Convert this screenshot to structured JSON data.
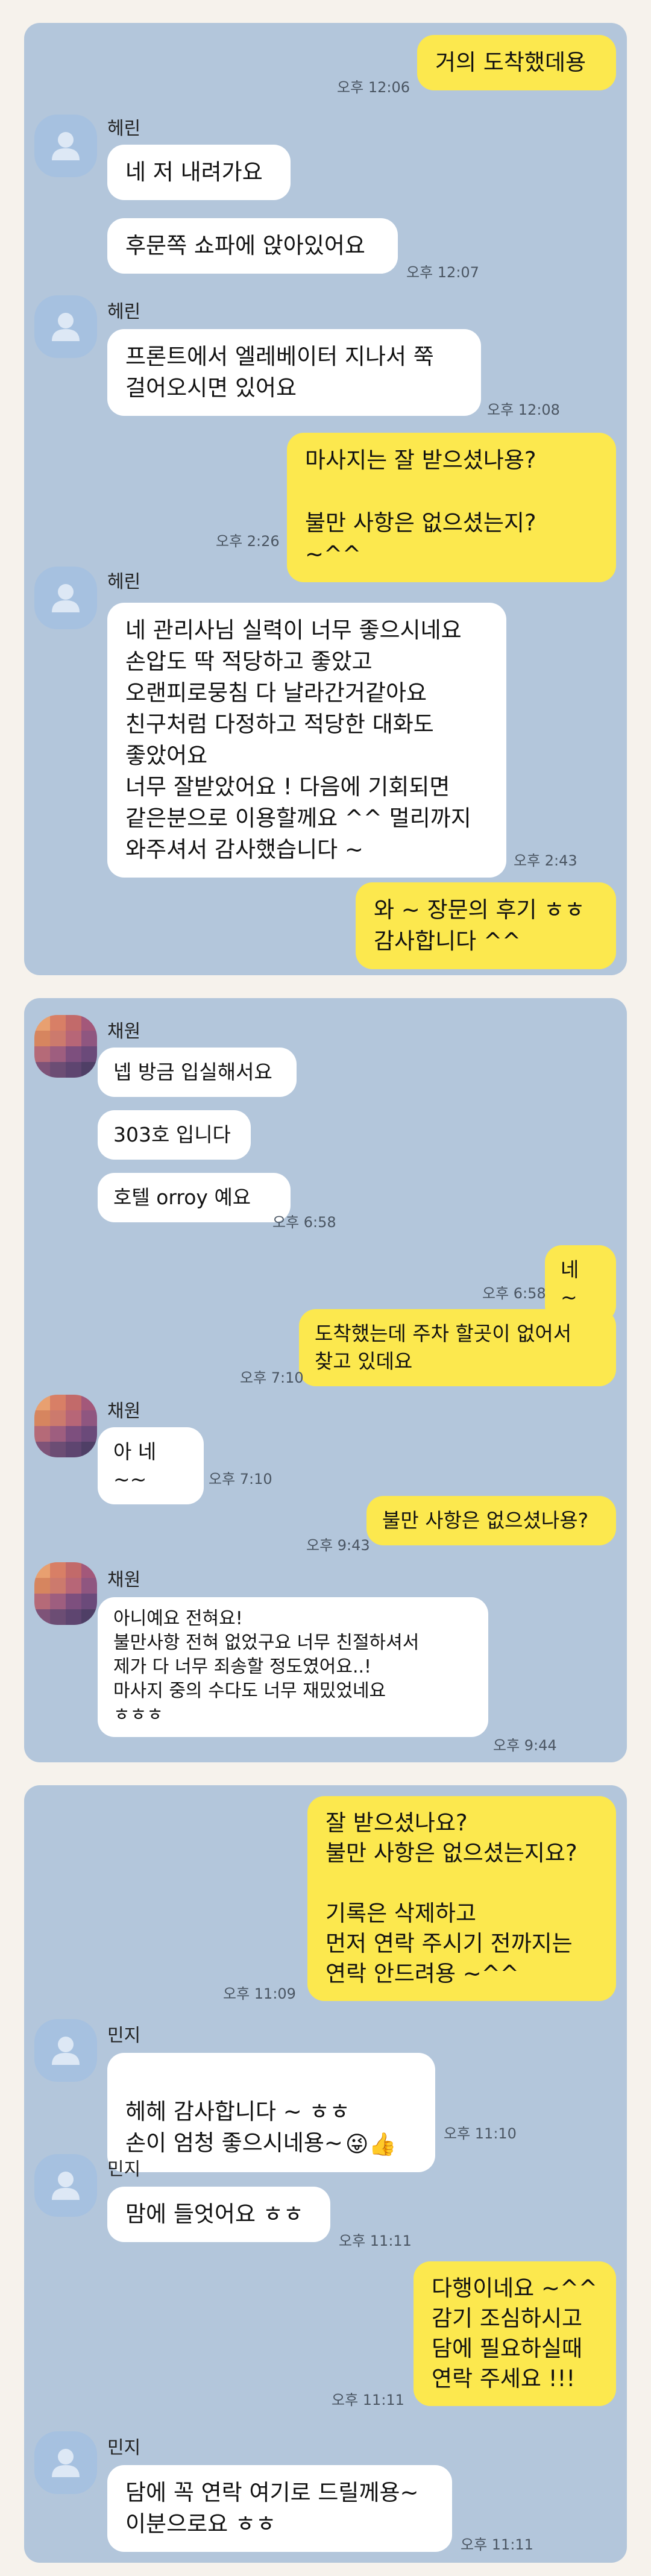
{
  "panel1": {
    "messages": [
      {
        "text": "거의 도착했데용",
        "time": "오후 12:06"
      },
      {
        "name": "헤린"
      },
      {
        "text": "네 저 내려가요"
      },
      {
        "text": "후문쪽 쇼파에 앉아있어요",
        "time": "오후 12:07"
      },
      {
        "name": "헤린"
      },
      {
        "text": "프론트에서 엘레베이터 지나서 쭉\n걸어오시면 있어요",
        "time": "오후 12:08"
      },
      {
        "text": "마사지는 잘 받으셨나용?\n\n불만 사항은 없으셨는지? ~^^",
        "time": "오후 2:26"
      },
      {
        "name": "헤린"
      },
      {
        "text": "네 관리사님 실력이 너무 좋으시네요\n손압도 딱 적당하고 좋았고\n오랜피로뭉침 다 날라간거같아요\n친구처럼 다정하고 적당한 대화도\n좋았어요\n너무 잘받았어요 ! 다음에 기회되면\n같은분으로 이용할께요 ^^ 멀리까지\n와주셔서 감사했습니다 ~",
        "time": "오후 2:43"
      },
      {
        "text": "와 ~ 장문의 후기 ㅎㅎ\n감사합니다 ^^"
      }
    ]
  },
  "panel2": {
    "messages": [
      {
        "name": "채원"
      },
      {
        "text": "넵 방금 입실해서요"
      },
      {
        "text": "303호 입니다"
      },
      {
        "text": "호텔 orroy 예요",
        "time": "오후 6:58"
      },
      {
        "text": "네 ~",
        "time": "오후 6:58"
      },
      {
        "text": "도착했는데  주차 할곳이 없어서\n찾고 있데요",
        "time": "오후 7:10"
      },
      {
        "name": "채원"
      },
      {
        "text": "아 네~~",
        "time": "오후 7:10"
      },
      {
        "text": "불만 사항은 없으셨나용?",
        "time": "오후 9:43"
      },
      {
        "name": "채원"
      },
      {
        "text": "아니예요 전혀요!\n불만사항 전혀 없었구요 너무 친절하셔서\n제가 다 너무 죄송할 정도였어요..!\n마사지 중의 수다도 너무 재밌었네요\nㅎㅎㅎ",
        "time": "오후 9:44"
      }
    ]
  },
  "panel3": {
    "messages": [
      {
        "text": "잘 받으셨나요?\n불만 사항은 없으셨는지요?\n\n기록은 삭제하고\n먼저 연락 주시기 전까지는\n연락 안드려용 ~^^",
        "time": "오후 11:09"
      },
      {
        "name": "민지"
      },
      {
        "text": "헤헤 감사합니다 ~ ㅎㅎ\n손이 엄청 좋으시네용~",
        "time": "오후 11:10",
        "emoji": "😜👍"
      },
      {
        "name": "민지"
      },
      {
        "text": "맘에 들엇어요 ㅎㅎ",
        "time": "오후 11:11"
      },
      {
        "text": "다행이네요 ~^^\n감기 조심하시고\n담에 필요하실때\n연락 주세요 !!!",
        "time": "오후 11:11"
      },
      {
        "name": "민지"
      },
      {
        "text": "담에 꼭 연락 여기로 드릴께용~\n이분으로요 ㅎㅎ",
        "time": "오후 11:11"
      }
    ]
  },
  "icons": {
    "default_avatar": "person-icon",
    "mosaic_avatar": "blurred-photo-avatar"
  },
  "colors": {
    "background": "#f6f2ec",
    "chat_panel": "#b3c6db",
    "incoming_bubble": "#ffffff",
    "outgoing_bubble": "#fce84e",
    "default_avatar": "#a6c1e0"
  }
}
